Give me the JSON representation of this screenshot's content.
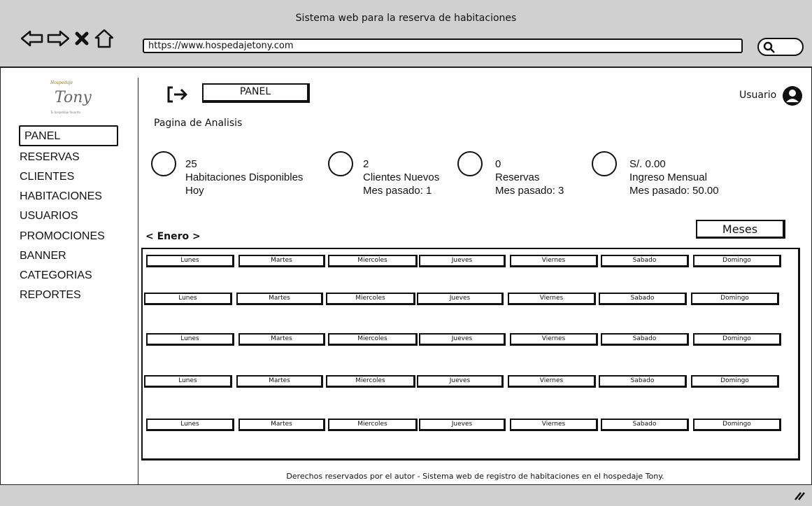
{
  "window": {
    "title": "Sistema web para la reserva de habitaciones"
  },
  "browser": {
    "url": "https://www.hospedajetony.com",
    "icons": [
      "back-arrow-icon",
      "forward-arrow-icon",
      "close-icon",
      "home-icon",
      "search-icon"
    ]
  },
  "logo": {
    "small": "Hospedaje",
    "name": "Tony",
    "tagline": "Tu hospedaje favorito"
  },
  "sidebar": {
    "items": [
      {
        "label": "PANEL",
        "active": true
      },
      {
        "label": "RESERVAS"
      },
      {
        "label": "CLIENTES"
      },
      {
        "label": "HABITACIONES"
      },
      {
        "label": "USUARIOS"
      },
      {
        "label": "PROMOCIONES"
      },
      {
        "label": "BANNER"
      },
      {
        "label": "CATEGORIAS"
      },
      {
        "label": "REPORTES"
      }
    ]
  },
  "header": {
    "panel_label": "PANEL",
    "user_label": "Usuario"
  },
  "page": {
    "title": "Pagina de Analisis"
  },
  "stats": [
    {
      "value": "25",
      "label": "Habitaciones Disponibles",
      "sub": "Hoy"
    },
    {
      "value": "2",
      "label": "Clientes Nuevos",
      "sub": "Mes pasado: 1"
    },
    {
      "value": "0",
      "label": "Reservas",
      "sub": "Mes pasado: 3"
    },
    {
      "value": "S/. 0.00",
      "label": "Ingreso Mensual",
      "sub": "Mes pasado: 50.00"
    }
  ],
  "calendar": {
    "month_nav": "< Enero >",
    "months_button": "Meses",
    "days": [
      "Lunes",
      "Martes",
      "Miercoles",
      "Jueves",
      "Viernes",
      "Sabado",
      "Domingo"
    ]
  },
  "footer": {
    "text": "Derechos reservados por el autor - Sistema web de registro de habitaciones en el hospedaje Tony."
  }
}
